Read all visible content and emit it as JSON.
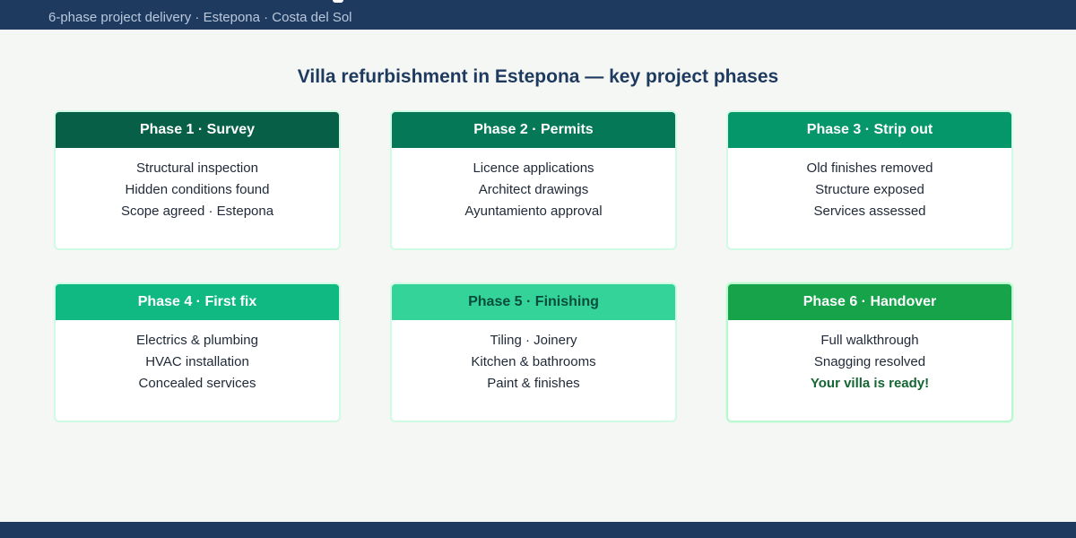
{
  "header": {
    "subtitle": "6-phase project delivery · Estepona · Costa del Sol"
  },
  "main": {
    "heading": "Villa refurbishment in Estepona — key project phases"
  },
  "colors": {
    "navy": "#1e3a5f",
    "phase1": "#065f46",
    "phase2": "#047857",
    "phase3": "#059669",
    "phase4": "#10b981",
    "phase5": "#34d399",
    "phase6": "#16a34a",
    "ready_text": "#166534"
  },
  "phases": [
    {
      "title": "Phase 1 · Survey",
      "lines": [
        "Structural inspection",
        "Hidden conditions found",
        "Scope agreed · Estepona"
      ]
    },
    {
      "title": "Phase 2 · Permits",
      "lines": [
        "Licence applications",
        "Architect drawings",
        "Ayuntamiento approval"
      ]
    },
    {
      "title": "Phase 3 · Strip out",
      "lines": [
        "Old finishes removed",
        "Structure exposed",
        "Services assessed"
      ]
    },
    {
      "title": "Phase 4 · First fix",
      "lines": [
        "Electrics & plumbing",
        "HVAC installation",
        "Concealed services"
      ]
    },
    {
      "title": "Phase 5 · Finishing",
      "lines": [
        "Tiling · Joinery",
        "Kitchen & bathrooms",
        "Paint & finishes"
      ]
    },
    {
      "title": "Phase 6 · Handover",
      "lines": [
        "Full walkthrough",
        "Snagging resolved",
        "Your villa is ready!"
      ]
    }
  ]
}
